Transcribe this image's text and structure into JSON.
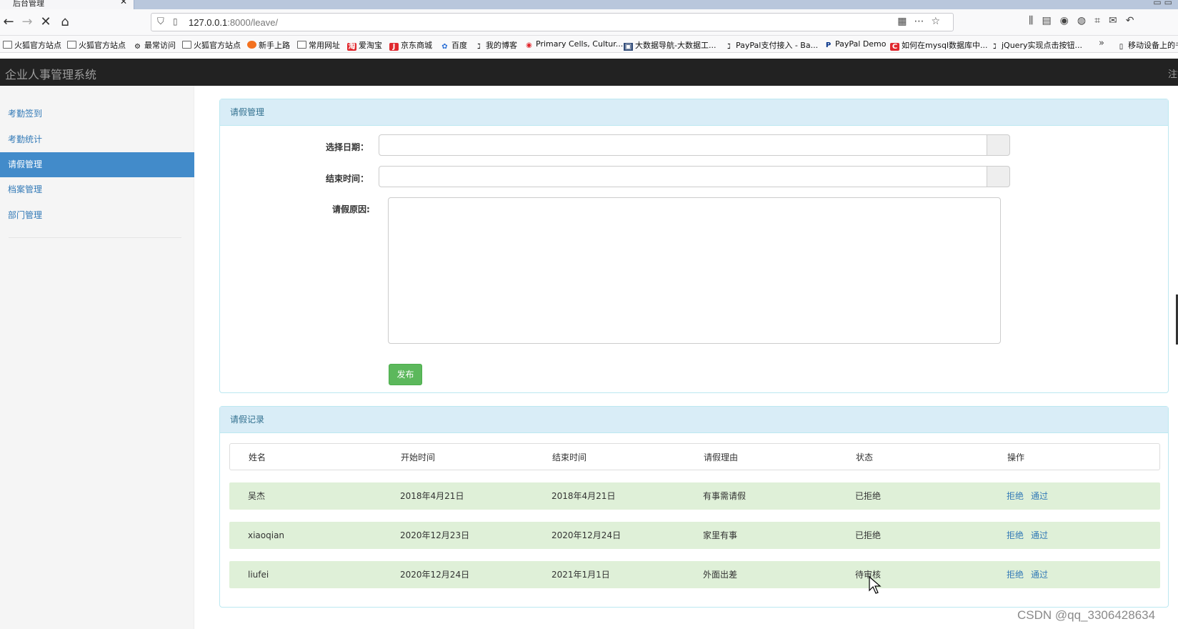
{
  "browser": {
    "tab_title": "后台管理",
    "tab_close": "✕",
    "url_host": "127.0.0.1",
    "url_path": ":8000/leave/",
    "bookmarks": [
      {
        "label": "火狐官方站点",
        "icon": "folder"
      },
      {
        "label": "火狐官方站点",
        "icon": "folder"
      },
      {
        "label": "最常访问",
        "icon": "gear"
      },
      {
        "label": "火狐官方站点",
        "icon": "folder"
      },
      {
        "label": "新手上路",
        "icon": "firefox"
      },
      {
        "label": "常用网址",
        "icon": "folder"
      },
      {
        "label": "爱淘宝",
        "icon": "taobao"
      },
      {
        "label": "京东商城",
        "icon": "jd"
      },
      {
        "label": "百度",
        "icon": "baidu"
      },
      {
        "label": "我的博客",
        "icon": "link"
      },
      {
        "label": "Primary Cells, Cultur...",
        "icon": "red-circle"
      },
      {
        "label": "大数据导航-大数据工...",
        "icon": "site"
      },
      {
        "label": "PayPal支付接入 - Ba...",
        "icon": "link"
      },
      {
        "label": "PayPal Demo",
        "icon": "paypal"
      },
      {
        "label": "如何在mysql数据库中...",
        "icon": "csdn"
      },
      {
        "label": "jQuery实现点击按钮...",
        "icon": "link"
      },
      {
        "label": "移动设备上的书",
        "icon": "mobile"
      }
    ]
  },
  "app": {
    "title": "企业人事管理系统",
    "header_right": "注销"
  },
  "sidebar": {
    "items": [
      {
        "label": "考勤签到",
        "active": false
      },
      {
        "label": "考勤统计",
        "active": false
      },
      {
        "label": "请假管理",
        "active": true
      },
      {
        "label": "档案管理",
        "active": false
      },
      {
        "label": "部门管理",
        "active": false
      }
    ]
  },
  "leave_form": {
    "heading": "请假管理",
    "start_label": "选择日期：",
    "start_value": "",
    "end_label": "结束时间：",
    "end_value": "",
    "reason_label": "请假原因:",
    "reason_value": "",
    "submit_label": "发布"
  },
  "records": {
    "heading": "请假记录",
    "columns": [
      "姓名",
      "开始时间",
      "结束时间",
      "请假理由",
      "状态",
      "操作"
    ],
    "rows": [
      {
        "name": "吴杰",
        "start": "2018年4月21日",
        "end": "2018年4月21日",
        "reason": "有事需请假",
        "status": "已拒绝",
        "reject": "拒绝",
        "approve": "通过"
      },
      {
        "name": "xiaoqian",
        "start": "2020年12月23日",
        "end": "2020年12月24日",
        "reason": "家里有事",
        "status": "已拒绝",
        "reject": "拒绝",
        "approve": "通过"
      },
      {
        "name": "liufei",
        "start": "2020年12月24日",
        "end": "2021年1月1日",
        "reason": "外面出差",
        "status": "待审核",
        "reject": "拒绝",
        "approve": "通过"
      }
    ]
  },
  "watermark": "CSDN @qq_3306428634",
  "colors": {
    "header_bg": "#222222",
    "sidebar_active": "#428bca",
    "panel_heading_bg": "#d9edf7",
    "row_bg": "#dff0d8",
    "button_green": "#5cb85c",
    "link_blue": "#337ab7"
  }
}
